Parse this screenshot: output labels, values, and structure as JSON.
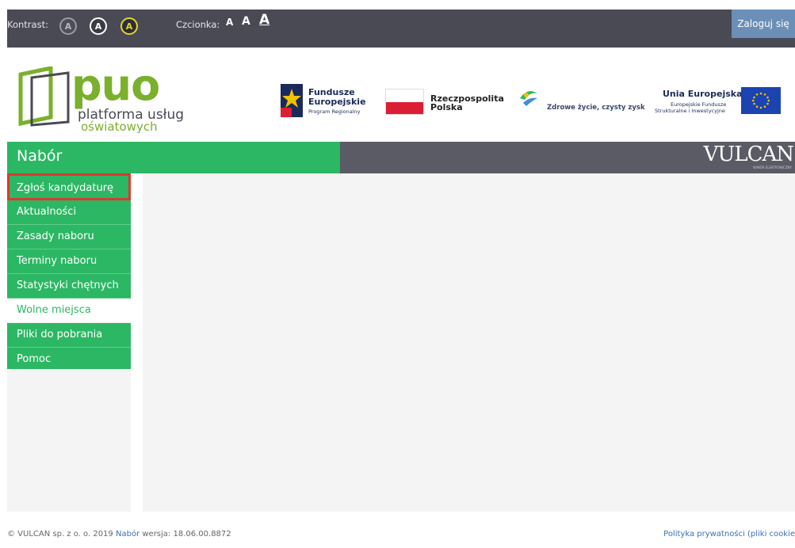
{
  "topbar": {
    "contrast_label": "Kontrast:",
    "contrast_buttons": [
      "A",
      "A",
      "A"
    ],
    "font_label": "Czcionka:",
    "font_buttons": [
      "A",
      "A",
      "A"
    ],
    "login_label": "Zaloguj się"
  },
  "logo": {
    "name": "puo",
    "line1": "platforma usług",
    "line2": "oświatowych"
  },
  "partners": {
    "fe_line1": "Fundusze",
    "fe_line2": "Europejskie",
    "fe_line3": "Program Regionalny",
    "pl_line1": "Rzeczpospolita",
    "pl_line2": "Polska",
    "zdr_text": "Zdrowe życie, czysty zysk",
    "ue_line1": "Unia Europejska",
    "ue_line2": "Europejskie Fundusze",
    "ue_line3": "Strukturalne i Inwestycyjne"
  },
  "header": {
    "title": "Nabór",
    "brand": "VULCAN",
    "brand_sub": "NABÓR ELEKTRONICZNY"
  },
  "sidebar": {
    "items": [
      {
        "label": "Zgłoś kandydaturę"
      },
      {
        "label": "Aktualności"
      },
      {
        "label": "Zasady naboru"
      },
      {
        "label": "Terminy naboru"
      },
      {
        "label": "Statystyki chętnych"
      },
      {
        "label": "Wolne miejsca"
      },
      {
        "label": "Pliki do pobrania"
      },
      {
        "label": "Pomoc"
      }
    ],
    "active_index": 5,
    "highlighted_index": 0
  },
  "footer": {
    "copyright": "© VULCAN sp. z o. o. 2019",
    "module_link": "Nabór",
    "version_label": "wersja:",
    "version": "18.06.00.8872",
    "privacy_link": "Polityka prywatności (pliki cookie"
  },
  "colors": {
    "green": "#2cb764",
    "dark": "#494a54",
    "highlight": "#d93a2f",
    "login": "#6b8fb6"
  }
}
